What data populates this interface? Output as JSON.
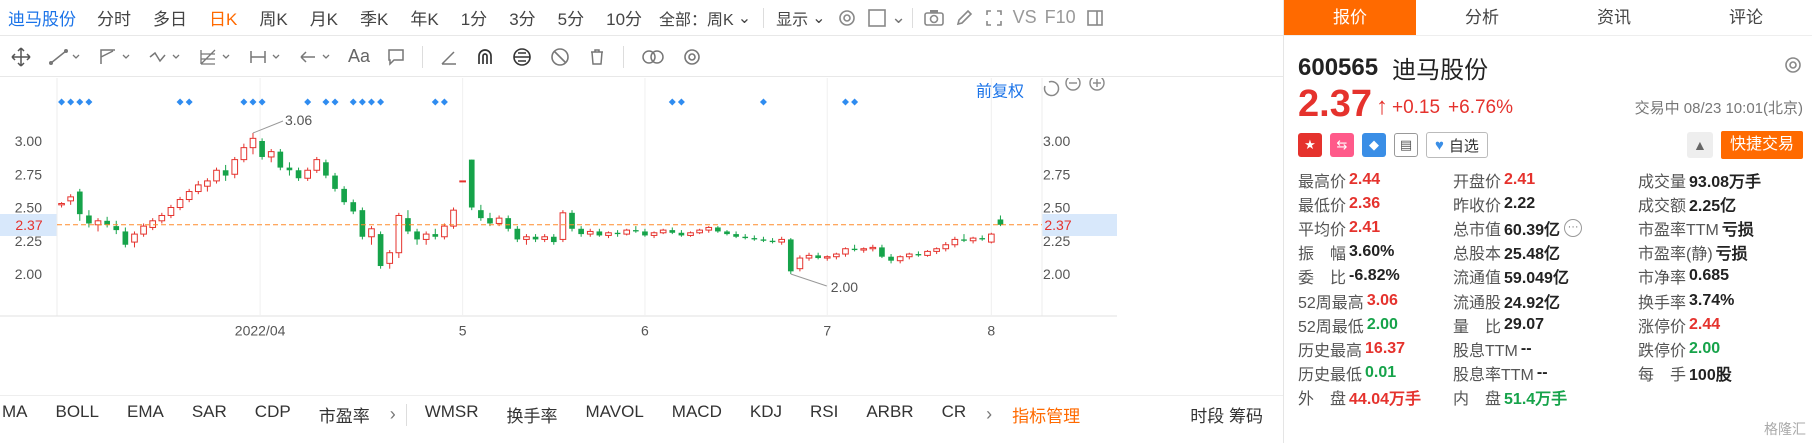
{
  "toolbar": {
    "stock_name": "迪马股份",
    "periods": [
      "分时",
      "多日",
      "日K",
      "周K",
      "月K",
      "季K",
      "年K",
      "1分",
      "3分",
      "5分",
      "10分"
    ],
    "active_period": "日K",
    "range_select": "全部：周K",
    "display_select": "显示",
    "vs_label": "VS",
    "f10_label": "F10"
  },
  "drawtools": {
    "font_label": "Aa"
  },
  "chart": {
    "adjust_label": "前复权",
    "high_mark": "3.06",
    "low_mark": "2.00",
    "current_price_label": "2.37",
    "left_ticks": [
      "3.00",
      "2.75",
      "2.50",
      "2.25",
      "2.00"
    ],
    "right_ticks": [
      "3.00",
      "2.75",
      "2.50",
      "2.25",
      "2.00"
    ],
    "x_labels": [
      "2022/04",
      "5",
      "6",
      "7",
      "8"
    ],
    "colors": {
      "up": "#e5322d",
      "down": "#16a34a",
      "marker": "#2f8cf0",
      "price_line": "#ff8c2b"
    }
  },
  "chart_data": {
    "type": "candlestick",
    "ylim": [
      1.85,
      3.15
    ],
    "current_price": 2.37,
    "annotations": [
      {
        "text": "3.06",
        "value": 3.06
      },
      {
        "text": "2.00",
        "value": 2.0
      }
    ],
    "x_tick_labels": [
      "2022/04",
      "5",
      "6",
      "7",
      "8"
    ],
    "candles": [
      [
        2.52,
        2.54,
        2.5,
        2.53
      ],
      [
        2.55,
        2.6,
        2.52,
        2.58
      ],
      [
        2.62,
        2.64,
        2.4,
        2.45
      ],
      [
        2.44,
        2.48,
        2.35,
        2.38
      ],
      [
        2.37,
        2.42,
        2.32,
        2.4
      ],
      [
        2.4,
        2.43,
        2.35,
        2.37
      ],
      [
        2.36,
        2.4,
        2.3,
        2.33
      ],
      [
        2.32,
        2.35,
        2.2,
        2.22
      ],
      [
        2.24,
        2.32,
        2.2,
        2.3
      ],
      [
        2.3,
        2.38,
        2.28,
        2.36
      ],
      [
        2.35,
        2.42,
        2.33,
        2.4
      ],
      [
        2.4,
        2.46,
        2.38,
        2.44
      ],
      [
        2.44,
        2.52,
        2.42,
        2.5
      ],
      [
        2.5,
        2.58,
        2.48,
        2.56
      ],
      [
        2.56,
        2.64,
        2.54,
        2.62
      ],
      [
        2.62,
        2.7,
        2.6,
        2.67
      ],
      [
        2.66,
        2.72,
        2.62,
        2.7
      ],
      [
        2.7,
        2.8,
        2.68,
        2.78
      ],
      [
        2.78,
        2.82,
        2.7,
        2.74
      ],
      [
        2.75,
        2.88,
        2.72,
        2.86
      ],
      [
        2.86,
        2.98,
        2.84,
        2.95
      ],
      [
        2.95,
        3.06,
        2.9,
        3.02
      ],
      [
        3.0,
        3.02,
        2.86,
        2.88
      ],
      [
        2.88,
        2.94,
        2.84,
        2.92
      ],
      [
        2.92,
        2.94,
        2.78,
        2.8
      ],
      [
        2.8,
        2.84,
        2.74,
        2.78
      ],
      [
        2.78,
        2.8,
        2.7,
        2.72
      ],
      [
        2.72,
        2.8,
        2.7,
        2.78
      ],
      [
        2.78,
        2.88,
        2.76,
        2.86
      ],
      [
        2.84,
        2.86,
        2.72,
        2.74
      ],
      [
        2.74,
        2.76,
        2.62,
        2.64
      ],
      [
        2.64,
        2.66,
        2.52,
        2.54
      ],
      [
        2.54,
        2.56,
        2.45,
        2.47
      ],
      [
        2.48,
        2.5,
        2.26,
        2.28
      ],
      [
        2.28,
        2.36,
        2.22,
        2.34
      ],
      [
        2.3,
        2.32,
        2.04,
        2.06
      ],
      [
        2.08,
        2.18,
        2.04,
        2.16
      ],
      [
        2.16,
        2.46,
        2.12,
        2.44
      ],
      [
        2.42,
        2.48,
        2.3,
        2.32
      ],
      [
        2.32,
        2.34,
        2.22,
        2.26
      ],
      [
        2.26,
        2.32,
        2.22,
        2.3
      ],
      [
        2.3,
        2.34,
        2.26,
        2.28
      ],
      [
        2.28,
        2.38,
        2.26,
        2.36
      ],
      [
        2.36,
        2.5,
        2.34,
        2.48
      ],
      [
        2.7,
        2.7,
        2.7,
        2.7
      ],
      [
        2.86,
        2.86,
        2.48,
        2.5
      ],
      [
        2.48,
        2.52,
        2.4,
        2.42
      ],
      [
        2.42,
        2.46,
        2.36,
        2.38
      ],
      [
        2.38,
        2.44,
        2.36,
        2.42
      ],
      [
        2.42,
        2.44,
        2.32,
        2.34
      ],
      [
        2.34,
        2.36,
        2.24,
        2.26
      ],
      [
        2.26,
        2.3,
        2.22,
        2.28
      ],
      [
        2.28,
        2.3,
        2.24,
        2.26
      ],
      [
        2.26,
        2.3,
        2.24,
        2.28
      ],
      [
        2.28,
        2.3,
        2.22,
        2.24
      ],
      [
        2.26,
        2.48,
        2.24,
        2.46
      ],
      [
        2.46,
        2.48,
        2.32,
        2.34
      ],
      [
        2.34,
        2.36,
        2.28,
        2.3
      ],
      [
        2.3,
        2.34,
        2.28,
        2.32
      ],
      [
        2.32,
        2.34,
        2.28,
        2.29
      ],
      [
        2.29,
        2.32,
        2.27,
        2.31
      ],
      [
        2.31,
        2.33,
        2.28,
        2.3
      ],
      [
        2.3,
        2.34,
        2.29,
        2.33
      ],
      [
        2.33,
        2.36,
        2.31,
        2.32
      ],
      [
        2.32,
        2.34,
        2.28,
        2.29
      ],
      [
        2.29,
        2.32,
        2.27,
        2.31
      ],
      [
        2.31,
        2.34,
        2.3,
        2.33
      ],
      [
        2.33,
        2.35,
        2.3,
        2.31
      ],
      [
        2.31,
        2.33,
        2.28,
        2.29
      ],
      [
        2.29,
        2.32,
        2.28,
        2.31
      ],
      [
        2.31,
        2.34,
        2.3,
        2.33
      ],
      [
        2.33,
        2.36,
        2.31,
        2.35
      ],
      [
        2.35,
        2.36,
        2.31,
        2.32
      ],
      [
        2.32,
        2.33,
        2.29,
        2.3
      ],
      [
        2.3,
        2.32,
        2.27,
        2.28
      ],
      [
        2.28,
        2.3,
        2.26,
        2.27
      ],
      [
        2.27,
        2.29,
        2.25,
        2.26
      ],
      [
        2.26,
        2.28,
        2.24,
        2.25
      ],
      [
        2.25,
        2.27,
        2.23,
        2.24
      ],
      [
        2.24,
        2.28,
        2.22,
        2.26
      ],
      [
        2.26,
        2.27,
        2.0,
        2.02
      ],
      [
        2.04,
        2.14,
        2.02,
        2.12
      ],
      [
        2.12,
        2.16,
        2.1,
        2.14
      ],
      [
        2.14,
        2.16,
        2.11,
        2.12
      ],
      [
        2.12,
        2.14,
        2.1,
        2.13
      ],
      [
        2.13,
        2.16,
        2.11,
        2.15
      ],
      [
        2.15,
        2.2,
        2.13,
        2.19
      ],
      [
        2.19,
        2.22,
        2.17,
        2.18
      ],
      [
        2.18,
        2.2,
        2.16,
        2.19
      ],
      [
        2.19,
        2.22,
        2.17,
        2.2
      ],
      [
        2.2,
        2.22,
        2.12,
        2.13
      ],
      [
        2.13,
        2.15,
        2.08,
        2.1
      ],
      [
        2.1,
        2.14,
        2.08,
        2.13
      ],
      [
        2.13,
        2.16,
        2.11,
        2.15
      ],
      [
        2.15,
        2.17,
        2.13,
        2.14
      ],
      [
        2.14,
        2.18,
        2.13,
        2.17
      ],
      [
        2.17,
        2.2,
        2.15,
        2.19
      ],
      [
        2.19,
        2.24,
        2.17,
        2.22
      ],
      [
        2.22,
        2.28,
        2.2,
        2.26
      ],
      [
        2.26,
        2.3,
        2.24,
        2.25
      ],
      [
        2.25,
        2.28,
        2.23,
        2.27
      ],
      [
        2.27,
        2.29,
        2.25,
        2.26
      ],
      [
        2.24,
        2.31,
        2.23,
        2.3
      ],
      [
        2.41,
        2.44,
        2.36,
        2.37
      ]
    ],
    "markers": [
      1,
      1,
      1,
      1,
      0,
      0,
      0,
      0,
      0,
      0,
      0,
      0,
      0,
      1,
      1,
      0,
      0,
      0,
      0,
      0,
      1,
      1,
      1,
      0,
      0,
      0,
      0,
      1,
      0,
      1,
      1,
      0,
      1,
      1,
      1,
      1,
      0,
      0,
      0,
      0,
      0,
      1,
      1,
      0,
      0,
      0,
      0,
      0,
      0,
      0,
      0,
      0,
      0,
      0,
      0,
      0,
      0,
      0,
      0,
      0,
      0,
      0,
      0,
      0,
      0,
      0,
      0,
      1,
      1,
      0,
      0,
      0,
      0,
      0,
      0,
      0,
      0,
      1,
      0,
      0,
      0,
      0,
      0,
      0,
      0,
      0,
      1,
      1
    ]
  },
  "indicators": {
    "items": [
      "MA",
      "BOLL",
      "EMA",
      "SAR",
      "CDP",
      "市盈率",
      "WMSR",
      "换手率",
      "MAVOL",
      "MACD",
      "KDJ",
      "RSI",
      "ARBR",
      "CR"
    ],
    "manage_label": "指标管理",
    "period_label": "时段",
    "chip_label": "筹码"
  },
  "quote": {
    "tabs": [
      "报价",
      "分析",
      "资讯",
      "评论"
    ],
    "active_tab": "报价",
    "code": "600565",
    "name": "迪马股份",
    "price": "2.37",
    "change": "+0.15",
    "change_pct": "+6.76%",
    "status_time": "交易中 08/23 10:01(北京)",
    "follow_label": "自选",
    "quick_trade_label": "快捷交易",
    "stats": [
      [
        {
          "label": "最高价",
          "value": "2.44",
          "tone": "red"
        },
        {
          "label": "开盘价",
          "value": "2.41",
          "tone": "red"
        },
        {
          "label": "成交量",
          "value": "93.08万手",
          "tone": "plain"
        }
      ],
      [
        {
          "label": "最低价",
          "value": "2.36",
          "tone": "red"
        },
        {
          "label": "昨收价",
          "value": "2.22",
          "tone": "plain"
        },
        {
          "label": "成交额",
          "value": "2.25亿",
          "tone": "plain"
        }
      ],
      [
        {
          "label": "平均价",
          "value": "2.41",
          "tone": "red"
        },
        {
          "label": "总市值",
          "value": "60.39亿",
          "tone": "plain"
        },
        {
          "label": "市盈率TTM",
          "value": "亏损",
          "tone": "plain"
        }
      ],
      [
        {
          "label": "振　幅",
          "value": "3.60%",
          "tone": "plain"
        },
        {
          "label": "总股本",
          "value": "25.48亿",
          "tone": "plain"
        },
        {
          "label": "市盈率(静)",
          "value": "亏损",
          "tone": "plain"
        }
      ],
      [
        {
          "label": "委　比",
          "value": "-6.82%",
          "tone": "plain"
        },
        {
          "label": "流通值",
          "value": "59.049亿",
          "tone": "plain"
        },
        {
          "label": "市净率",
          "value": "0.685",
          "tone": "plain"
        }
      ],
      [
        {
          "label": "52周最高",
          "value": "3.06",
          "tone": "red"
        },
        {
          "label": "流通股",
          "value": "24.92亿",
          "tone": "plain"
        },
        {
          "label": "换手率",
          "value": "3.74%",
          "tone": "plain"
        }
      ],
      [
        {
          "label": "52周最低",
          "value": "2.00",
          "tone": "green"
        },
        {
          "label": "量　比",
          "value": "29.07",
          "tone": "plain"
        },
        {
          "label": "涨停价",
          "value": "2.44",
          "tone": "red"
        }
      ],
      [
        {
          "label": "历史最高",
          "value": "16.37",
          "tone": "red"
        },
        {
          "label": "股息TTM",
          "value": "--",
          "tone": "plain"
        },
        {
          "label": "跌停价",
          "value": "2.00",
          "tone": "green"
        }
      ],
      [
        {
          "label": "历史最低",
          "value": "0.01",
          "tone": "green"
        },
        {
          "label": "股息率TTM",
          "value": "--",
          "tone": "plain"
        },
        {
          "label": "每　手",
          "value": "100股",
          "tone": "plain"
        }
      ],
      [
        {
          "label": "外　盘",
          "value": "44.04万手",
          "tone": "red"
        },
        {
          "label": "内　盘",
          "value": "51.4万手",
          "tone": "green"
        },
        {
          "label": "",
          "value": "",
          "tone": "plain"
        }
      ]
    ]
  },
  "watermark": "格隆汇"
}
